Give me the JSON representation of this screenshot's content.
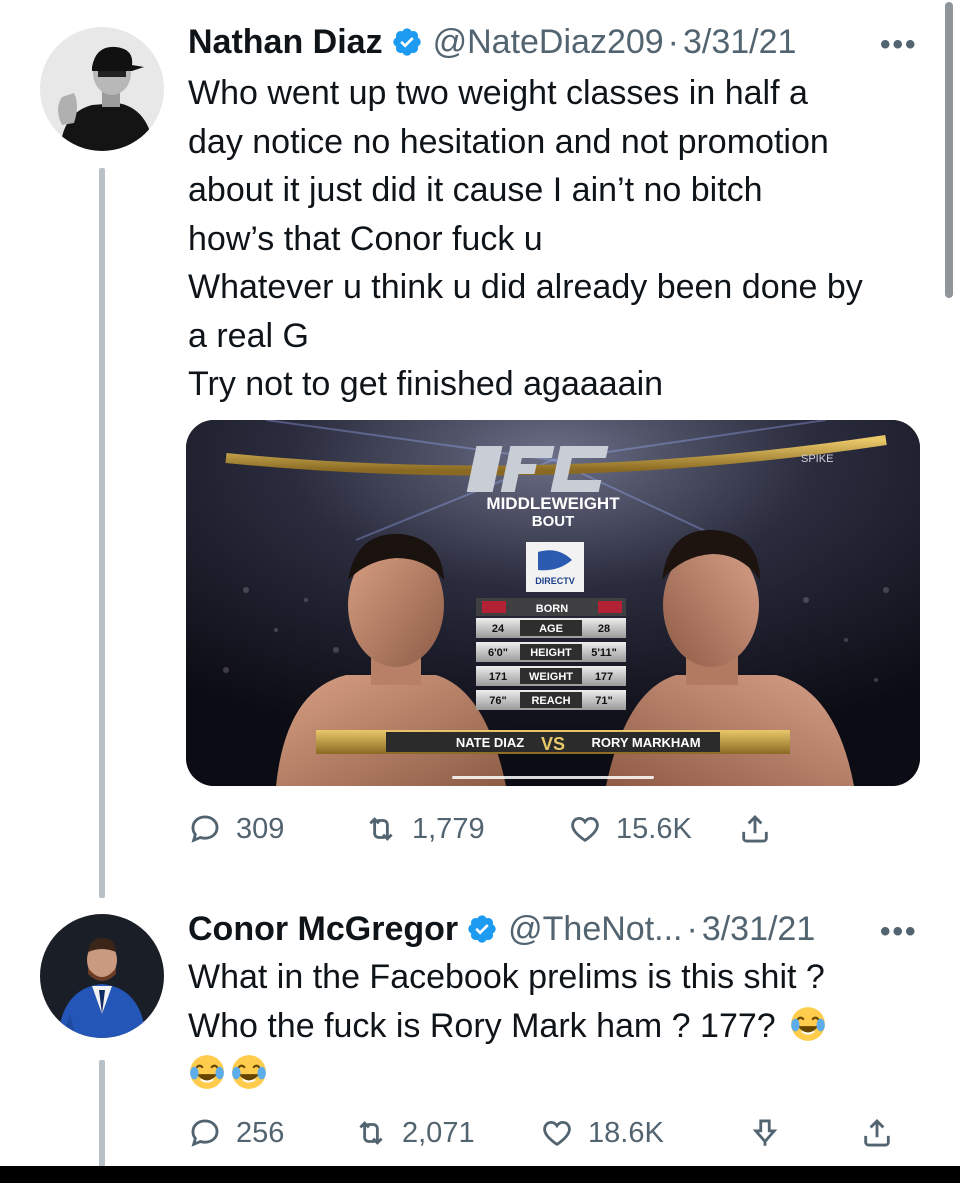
{
  "tweets": [
    {
      "name": "Nathan Diaz",
      "handle": "@NateDiaz209",
      "date": "3/31/21",
      "more": "•••",
      "lines": [
        "Who went up two weight classes in half a",
        "day notice no hesitation and not promotion",
        "about it just did it cause I ain’t no bitch",
        "how’s that Conor fuck u",
        "Whatever u think u did already been done by",
        "a real G",
        "Try not to get finished agaaaain"
      ],
      "media": {
        "title_line1": "MIDDLEWEIGHT",
        "title_line2": "BOUT",
        "sponsor": "DIRECTV",
        "network": "SPIKE",
        "stats_header": "BORN",
        "stats": [
          {
            "label": "AGE",
            "left": "24",
            "right": "28"
          },
          {
            "label": "HEIGHT",
            "left": "6'0\"",
            "right": "5'11\""
          },
          {
            "label": "WEIGHT",
            "left": "171",
            "right": "177"
          },
          {
            "label": "REACH",
            "left": "76\"",
            "right": "71\""
          }
        ],
        "fighter_left": "NATE DIAZ",
        "vs": "VS",
        "fighter_right": "RORY MARKHAM"
      },
      "replies": "309",
      "retweets": "1,779",
      "likes": "15.6K"
    },
    {
      "name": "Conor McGregor",
      "handle": "@TheNot...",
      "date": "3/31/21",
      "more": "•••",
      "lines": [
        "What in the Facebook prelims is this shit ?",
        "Who the fuck is Rory Mark ham ? 177?"
      ],
      "emoji": "face-with-tears-of-joy",
      "replies": "256",
      "retweets": "2,071",
      "likes": "18.6K"
    }
  ],
  "colors": {
    "text": "#0f1419",
    "secondary": "#536471",
    "verified": "#1d9bf0",
    "thread_line": "#b9c1c8"
  }
}
